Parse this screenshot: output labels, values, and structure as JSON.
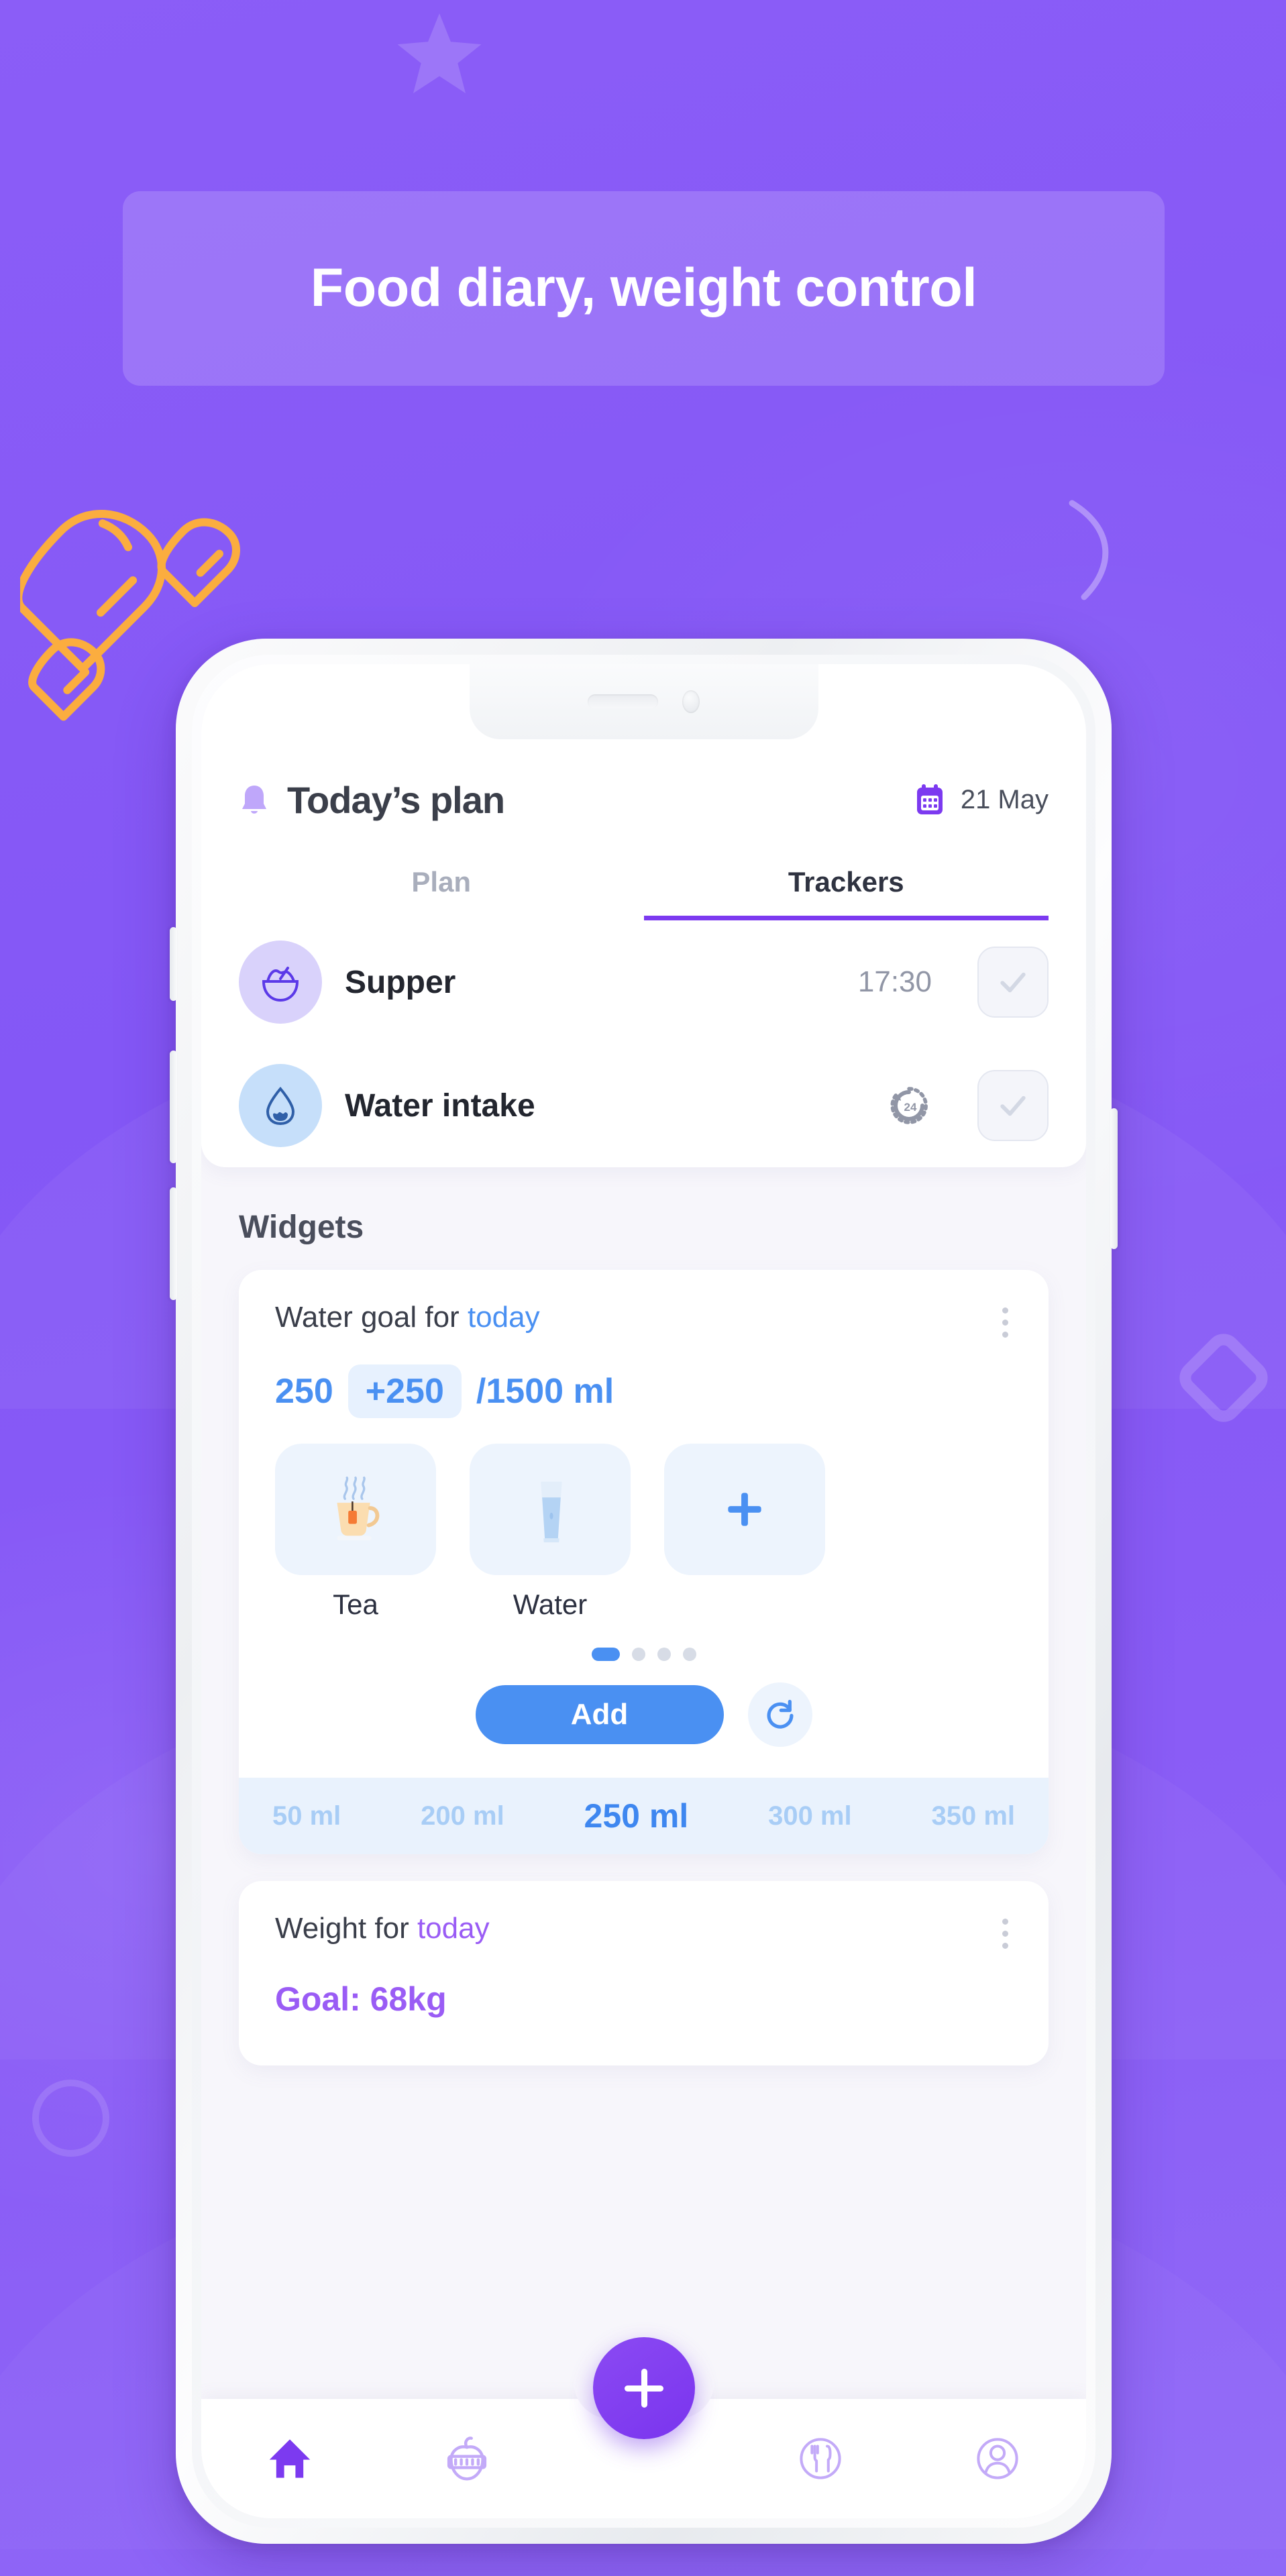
{
  "banner": {
    "headline": "Food diary, weight control"
  },
  "colors": {
    "background_purple": "#8A5CF6",
    "brand_purple": "#7C3AF0",
    "accent_blue": "#4A90F2",
    "accent_orange": "#FBAD3F",
    "text_dark": "#23262F",
    "text_muted": "#9196A6"
  },
  "app": {
    "header": {
      "bell_icon": "bell-icon",
      "title": "Today’s plan",
      "calendar_icon": "calendar-icon",
      "date": "21 May"
    },
    "tabs": [
      {
        "label": "Plan",
        "active": false
      },
      {
        "label": "Trackers",
        "active": true
      }
    ],
    "trackers": [
      {
        "icon": "bowl-icon",
        "name": "Supper",
        "meta": "17:30",
        "meta_type": "time",
        "check_icon": "check-icon"
      },
      {
        "icon": "water-drop-icon",
        "name": "Water intake",
        "meta": "24",
        "meta_type": "24h-clock-icon",
        "check_icon": "check-icon"
      }
    ],
    "widgets_heading": "Widgets",
    "water_widget": {
      "title_prefix": "Water goal for ",
      "title_accent": "today",
      "kebab_icon": "more-options-icon",
      "current": "250",
      "increment": "+250",
      "goal": "/1500 ml",
      "drinks": [
        {
          "label": "Tea",
          "icon": "tea-cup-icon"
        },
        {
          "label": "Water",
          "icon": "water-glass-icon"
        },
        {
          "label": "",
          "icon": "plus-icon"
        }
      ],
      "dots": [
        true,
        false,
        false,
        false
      ],
      "add_label": "Add",
      "refresh_icon": "refresh-icon",
      "amounts": [
        {
          "label": "50 ml",
          "selected": false
        },
        {
          "label": "200 ml",
          "selected": false
        },
        {
          "label": "250 ml",
          "selected": true
        },
        {
          "label": "300 ml",
          "selected": false
        },
        {
          "label": "350 ml",
          "selected": false
        }
      ]
    },
    "weight_widget": {
      "title_prefix": "Weight for ",
      "title_accent": "today",
      "kebab_icon": "more-options-icon",
      "goal": "Goal: 68kg"
    },
    "bottom_nav": [
      {
        "icon": "home-icon",
        "active": true
      },
      {
        "icon": "apple-measure-icon",
        "active": false
      },
      {
        "icon": "cutlery-plate-icon",
        "active": false
      },
      {
        "icon": "profile-icon",
        "active": false
      }
    ],
    "fab_icon": "plus-icon"
  }
}
